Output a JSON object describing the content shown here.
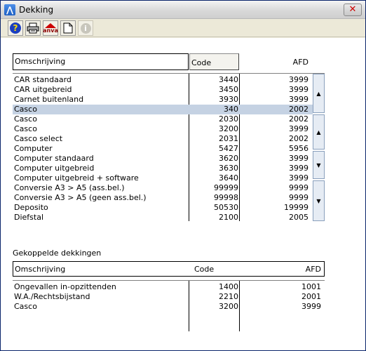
{
  "window": {
    "title": "Dekking",
    "close_glyph": "✕",
    "app_icon": "app-icon"
  },
  "toolbar": {
    "buttons": [
      {
        "name": "help-button",
        "icon": "help-icon",
        "glyph": "?"
      },
      {
        "name": "print-button",
        "icon": "printer-icon"
      },
      {
        "name": "anva-button",
        "icon": "anva-logo-icon",
        "glyph": "anva"
      },
      {
        "name": "new-document-button",
        "icon": "document-icon"
      },
      {
        "name": "info-button",
        "icon": "info-icon",
        "glyph": "i",
        "disabled": true
      }
    ]
  },
  "main_list": {
    "columns": {
      "omschrijving": "Omschrijving",
      "code": "Code",
      "afd": "AFD"
    },
    "rows": [
      {
        "omschrijving": "CAR standaard",
        "code": "3440",
        "afd": "3999"
      },
      {
        "omschrijving": "CAR uitgebreid",
        "code": "3450",
        "afd": "3999"
      },
      {
        "omschrijving": "Carnet buitenland",
        "code": "3930",
        "afd": "3999"
      },
      {
        "omschrijving": "Casco",
        "code": "340",
        "afd": "2002",
        "selected": true
      },
      {
        "omschrijving": "Casco",
        "code": "2030",
        "afd": "2002"
      },
      {
        "omschrijving": "Casco",
        "code": "3200",
        "afd": "3999"
      },
      {
        "omschrijving": "Casco select",
        "code": "2031",
        "afd": "2002"
      },
      {
        "omschrijving": "Computer",
        "code": "5427",
        "afd": "5956"
      },
      {
        "omschrijving": "Computer standaard",
        "code": "3620",
        "afd": "3999"
      },
      {
        "omschrijving": "Computer uitgebreid",
        "code": "3630",
        "afd": "3999"
      },
      {
        "omschrijving": "Computer uitgebreid + software",
        "code": "3640",
        "afd": "3999"
      },
      {
        "omschrijving": "Conversie A3 > A5 (ass.bel.)",
        "code": "99999",
        "afd": "9999"
      },
      {
        "omschrijving": "Conversie A3 > A5 (geen ass.bel.)",
        "code": "99998",
        "afd": "9999"
      },
      {
        "omschrijving": "Deposito",
        "code": "50530",
        "afd": "19999"
      },
      {
        "omschrijving": "Diefstal",
        "code": "2100",
        "afd": "2005"
      }
    ],
    "scroll_buttons": [
      {
        "name": "scroll-top-button",
        "icon": "arrow-up-icon",
        "glyph": "▲"
      },
      {
        "name": "scroll-page-up-button",
        "icon": "arrow-up-icon",
        "glyph": "▲"
      },
      {
        "name": "scroll-page-down-button",
        "icon": "arrow-down-icon",
        "glyph": "▼"
      },
      {
        "name": "scroll-bottom-button",
        "icon": "arrow-down-icon",
        "glyph": "▼"
      }
    ]
  },
  "linked": {
    "label": "Gekoppelde dekkingen",
    "columns": {
      "omschrijving": "Omschrijving",
      "code": "Code",
      "afd": "AFD"
    },
    "rows": [
      {
        "omschrijving": "Ongevallen in-opzittenden",
        "code": "1400",
        "afd": "1001"
      },
      {
        "omschrijving": "W.A./Rechtsbijstand",
        "code": "2210",
        "afd": "2001"
      },
      {
        "omschrijving": "Casco",
        "code": "3200",
        "afd": "3999"
      }
    ]
  }
}
